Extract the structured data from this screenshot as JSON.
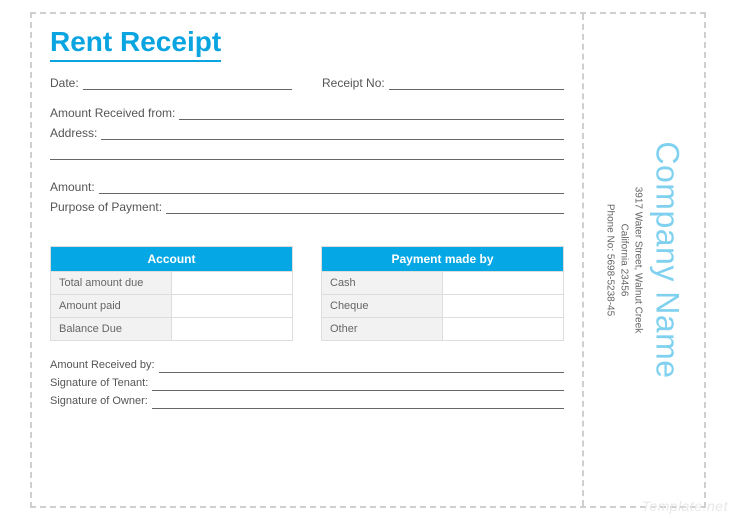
{
  "title": "Rent Receipt",
  "fields": {
    "date": "Date:",
    "receipt_no": "Receipt No:",
    "amount_received_from": "Amount Received from:",
    "address": "Address:",
    "amount": "Amount:",
    "purpose": "Purpose of Payment:"
  },
  "account": {
    "header": "Account",
    "rows": [
      "Total amount due",
      "Amount paid",
      "Balance Due"
    ]
  },
  "payment": {
    "header": "Payment made by",
    "rows": [
      "Cash",
      "Cheque",
      "Other"
    ]
  },
  "signatures": {
    "received_by": "Amount Received by:",
    "tenant": "Signature of Tenant:",
    "owner": "Signature of Owner:"
  },
  "company": {
    "name": "Company Name",
    "street": "3917 Water Street, Walnut Creek",
    "region": "California 23456",
    "phone": "Phone No: 5698-5238-45"
  },
  "watermark": "Template.net"
}
